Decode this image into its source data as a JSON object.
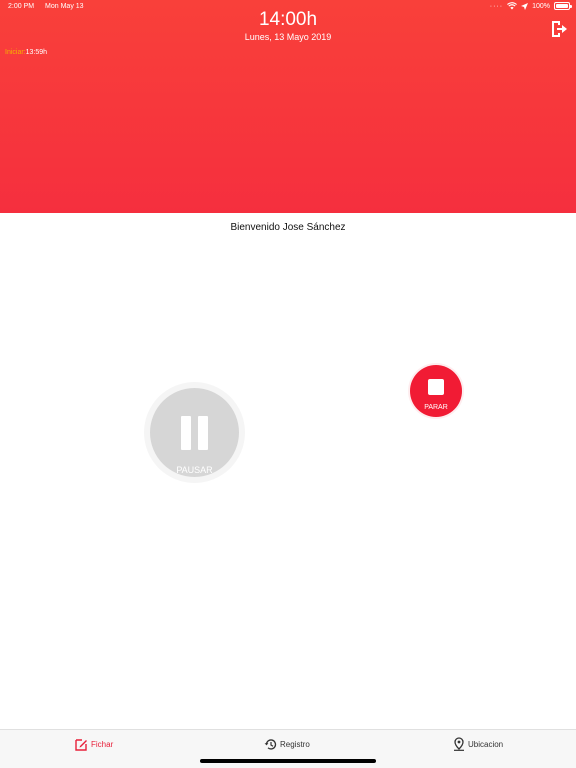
{
  "status_bar": {
    "time": "2:00 PM",
    "date": "Mon May 13",
    "battery": "100%",
    "battery_level_percent": 100
  },
  "header": {
    "clock": "14:00h",
    "date": "Lunes, 13 Mayo 2019",
    "start_label": "Iniciar:",
    "start_time": "13:59h",
    "gradient_top": "#f9403a",
    "gradient_bottom": "#f52f3e"
  },
  "main": {
    "welcome": "Bienvenido Jose Sánchez",
    "pause_label": "PAUSAR",
    "stop_label": "PARAR",
    "stop_color": "#f11b34"
  },
  "tabbar": {
    "items": [
      {
        "label": "Fichar",
        "icon": "edit-icon",
        "active": true
      },
      {
        "label": "Registro",
        "icon": "history-icon",
        "active": false
      },
      {
        "label": "Ubicacion",
        "icon": "location-pin-icon",
        "active": false
      }
    ],
    "active_color": "#e8203a"
  }
}
